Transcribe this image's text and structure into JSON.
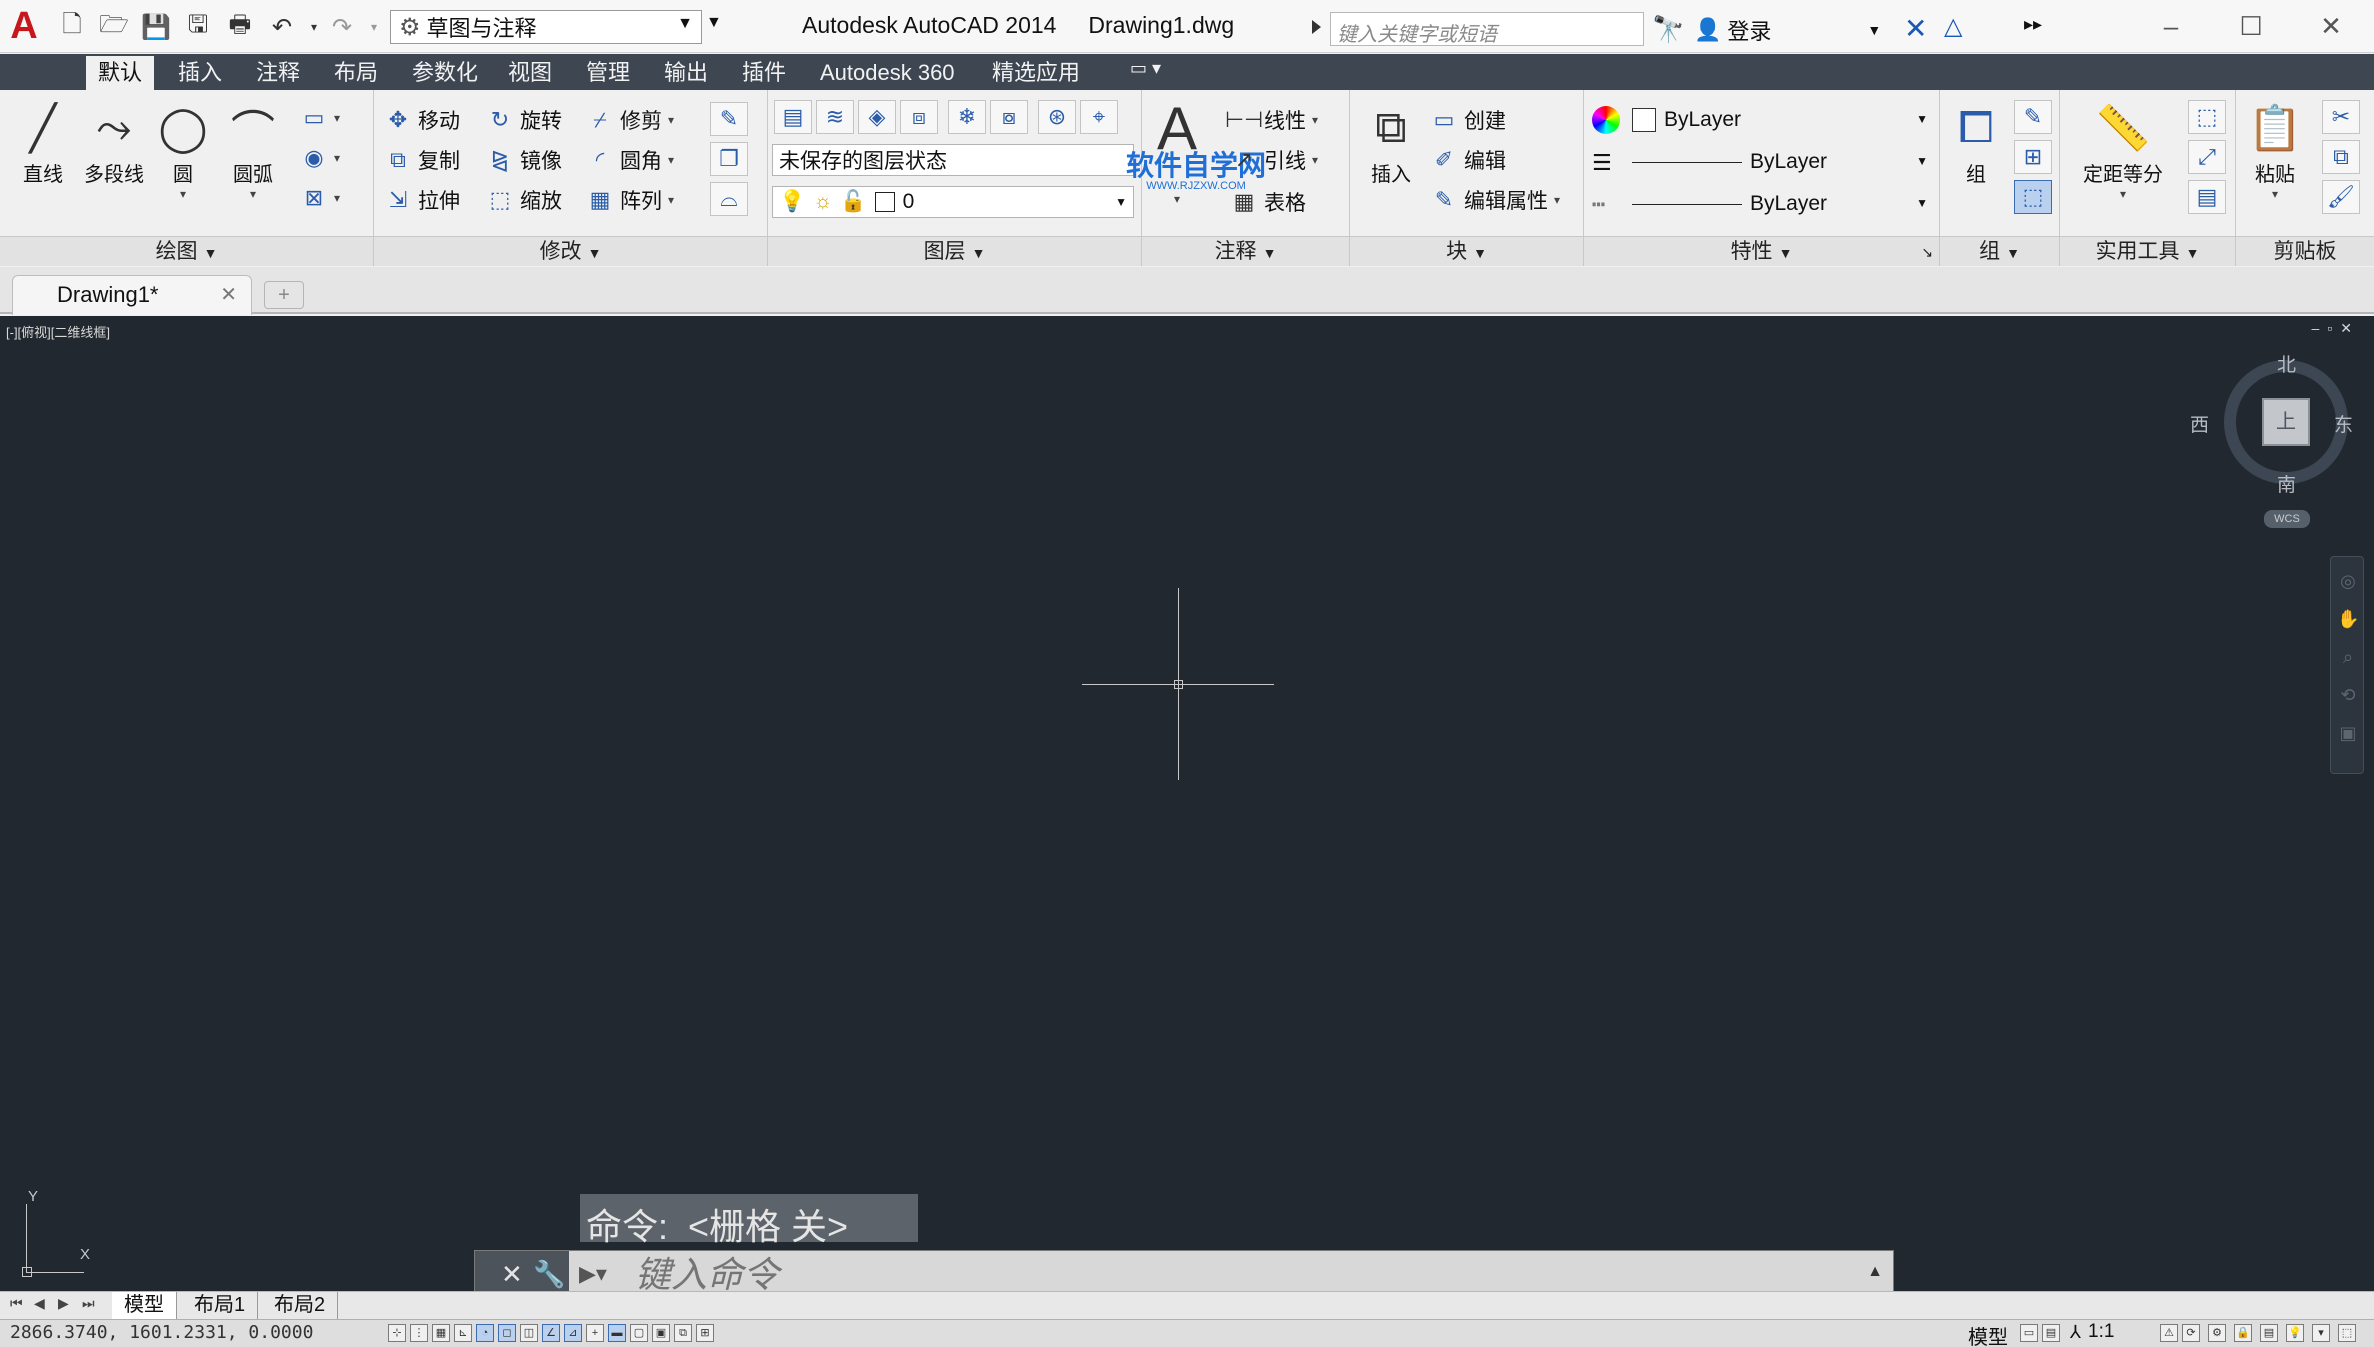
{
  "titlebar": {
    "workspace": "草图与注释",
    "app_title": "Autodesk AutoCAD 2014",
    "doc_name": "Drawing1.dwg",
    "search_placeholder": "键入关键字或短语",
    "login": "登录"
  },
  "ribbon_tabs": [
    "默认",
    "插入",
    "注释",
    "布局",
    "参数化",
    "视图",
    "管理",
    "输出",
    "插件",
    "Autodesk 360",
    "精选应用"
  ],
  "panels": {
    "draw": {
      "title": "绘图",
      "tools": [
        "直线",
        "多段线",
        "圆",
        "圆弧"
      ]
    },
    "modify": {
      "title": "修改",
      "tools": [
        "移动",
        "旋转",
        "修剪",
        "复制",
        "镜像",
        "圆角",
        "拉伸",
        "缩放",
        "阵列"
      ]
    },
    "layers": {
      "title": "图层",
      "layer_state": "未保存的图层状态",
      "current_layer": "0"
    },
    "annotation": {
      "title": "注释",
      "big_label": "文字",
      "tools": [
        "线性",
        "引线",
        "表格"
      ],
      "watermark_line1": "软件自学网",
      "watermark_line2": "WWW.RJZXW.COM"
    },
    "block": {
      "title": "块",
      "insert": "插入",
      "tools": [
        "创建",
        "编辑",
        "编辑属性"
      ]
    },
    "properties": {
      "title": "特性",
      "color": "ByLayer",
      "lineweight": "ByLayer",
      "linetype": "ByLayer"
    },
    "groups": {
      "title": "组",
      "group": "组"
    },
    "utilities": {
      "title": "实用工具",
      "measure": "定距等分"
    },
    "clipboard": {
      "title": "剪贴板",
      "paste": "粘贴"
    }
  },
  "doc_tab": {
    "label": "Drawing1*"
  },
  "canvas": {
    "viewport_label": "[-][俯视][二维线框]",
    "viewcube": {
      "north": "北",
      "south": "南",
      "east": "东",
      "west": "西",
      "face": "上",
      "wcs": "WCS"
    },
    "ucs": {
      "x": "X",
      "y": "Y"
    }
  },
  "command": {
    "history": "命令:  <栅格 关>",
    "placeholder": "键入命令"
  },
  "layout_tabs": [
    "模型",
    "布局1",
    "布局2"
  ],
  "status": {
    "coords": "2866.3740, 1601.2331, 0.0000",
    "model": "模型",
    "scale": "1:1"
  },
  "colors": {
    "canvas_bg": "#212830",
    "ribbon_tab_bg": "#3e4652",
    "brand_red": "#c8161d",
    "watermark_blue": "#1f6fd6"
  }
}
